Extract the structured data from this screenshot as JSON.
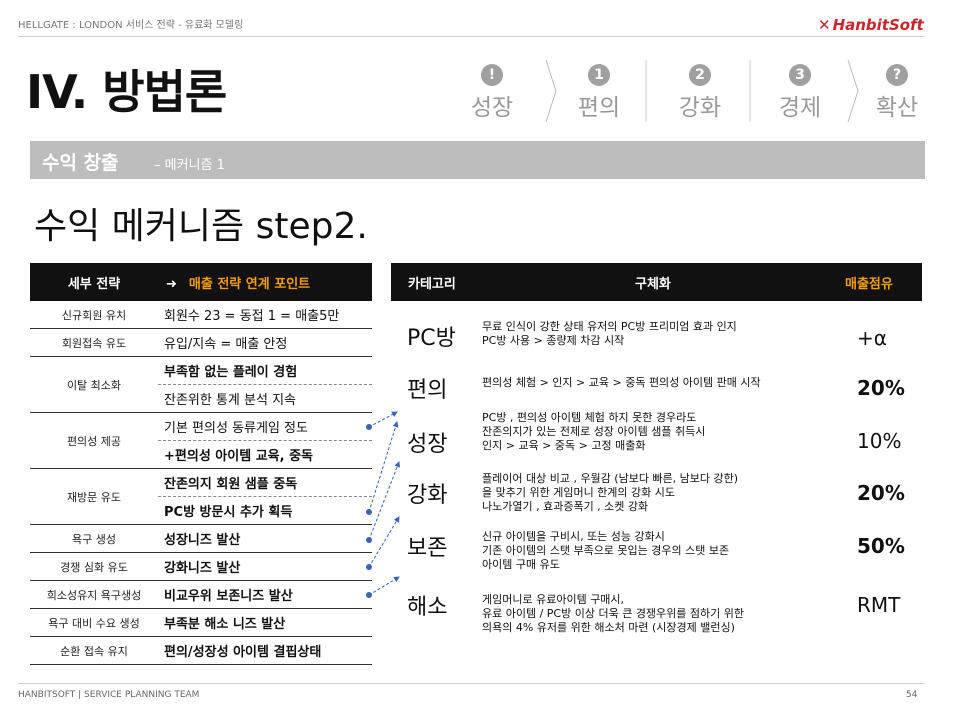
{
  "header": {
    "doc_title": "HELLGATE : LONDON 서비스 전략 - 유료화 모델링",
    "logo": "HanbitSoft"
  },
  "title": "IV. 방법론",
  "steps": [
    {
      "num": "!",
      "label": "성장"
    },
    {
      "num": "1",
      "label": "편의"
    },
    {
      "num": "2",
      "label": "강화"
    },
    {
      "num": "3",
      "label": "경제"
    },
    {
      "num": "?",
      "label": "확산"
    }
  ],
  "band": {
    "main": "수익 창출",
    "sub": "– 메커니즘 1"
  },
  "subtitle": "수익 메커니즘 step2.",
  "left_table": {
    "head1": "세부 전략",
    "head2": "매출 전략 연계 포인트",
    "rows": [
      {
        "c1": "신규회원 유치",
        "c2": "회원수 23 = 동접 1 = 매출5만"
      },
      {
        "c1": "회원접속 유도",
        "c2": "유입/지속 = 매출 안정"
      },
      {
        "c1": "이탈 최소화",
        "c2a": "부족함 없는 플레이 경험",
        "c2b": "잔존위한 통계 분석 지속"
      },
      {
        "c1": "편의성 제공",
        "c2a": "기본 편의성 동류게임 정도",
        "c2b": "+편의성 아이템 교육, 중독"
      },
      {
        "c1": "재방문 유도",
        "c2a": "잔존의지 회원 샘플 중독",
        "c2b": "PC방 방문시 추가 획득"
      },
      {
        "c1": "욕구 생성",
        "c2": "성장니즈 발산"
      },
      {
        "c1": "경쟁 심화 유도",
        "c2": "강화니즈 발산"
      },
      {
        "c1": "희소성유지 욕구생성",
        "c2": "비교우위 보존니즈 발산"
      },
      {
        "c1": "욕구 대비 수요 생성",
        "c2": "부족분 해소 니즈 발산"
      },
      {
        "c1": "순환 접속 유지",
        "c2": "편의/성장성 아이템 결핍상태"
      }
    ]
  },
  "right_table": {
    "head_cat": "카테고리",
    "head_desc": "구체화",
    "head_val": "매출점유",
    "rows": [
      {
        "cat": "PC방",
        "desc": [
          "무료 인식이 강한 상태 유저의 PC방 프리미엄 효과 인지",
          "PC방 사용 > 종량제 차감 시작"
        ],
        "val": "+α"
      },
      {
        "cat": "편의",
        "desc": [
          "편의성 체험 > 인지 > 교육 > 중독 편의성 아이템 판매 시작"
        ],
        "val": "20%"
      },
      {
        "cat": "성장",
        "desc": [
          "PC방 , 편의성 아이템 체험 하지 못한 경우라도",
          "잔존의지가 있는 전제로 성장 아이템 샘플 취득시",
          "인지 > 교육 > 중독 > 고정 매출화"
        ],
        "val": "10%"
      },
      {
        "cat": "강화",
        "desc": [
          "플레이어 대상 비교 , 우월감 (남보다 빠른, 남보다 강한)",
          "을 맞추기 위한 게임머니 한계의 강화 시도",
          "나노가열기 , 효과증폭기 , 소켓 강화"
        ],
        "val": "20%"
      },
      {
        "cat": "보존",
        "desc": [
          "신규 아이템을 구비시, 또는 성능 강화시",
          "기존 아이템의 스탯 부족으로 못입는 경우의 스탯 보존",
          "아이템 구매 유도"
        ],
        "val": "50%"
      },
      {
        "cat": "해소",
        "desc": [
          "게임머니로 유료아이템 구매시,",
          "유료 아이템 / PC방 이상 더욱 큰 경쟁우위를 점하기 위한",
          "의욕의 4% 유저를 위한 해소처 마련 (시장경제 밸런싱)"
        ],
        "val": "RMT"
      }
    ]
  },
  "footer": "HANBITSOFT | SERVICE PLANNING TEAM",
  "page": "54",
  "colors": {
    "accent": "#f39c12",
    "band": "#bdbdbd",
    "header_bg": "#111111",
    "arrow": "#3b63b3",
    "logo": "#c8262c"
  }
}
